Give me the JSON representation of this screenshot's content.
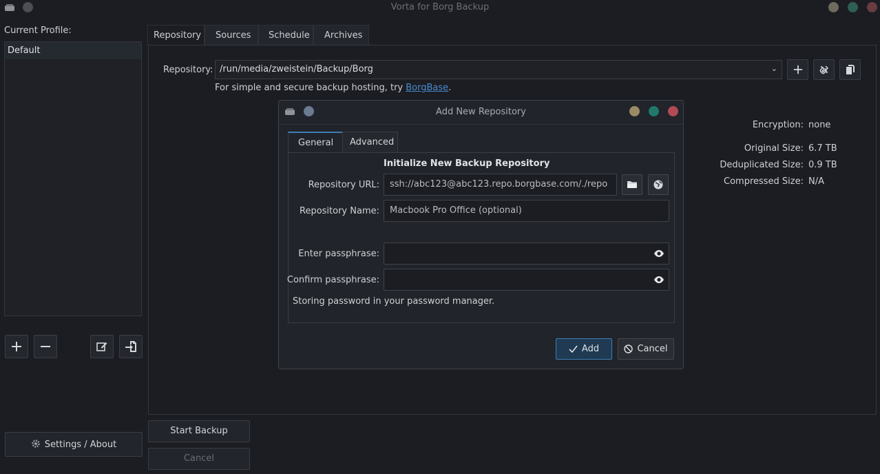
{
  "window": {
    "title": "Vorta for Borg Backup"
  },
  "sidebar": {
    "current_profile_label": "Current Profile:",
    "profiles": [
      "Default"
    ],
    "settings_label": "Settings / About"
  },
  "main_tabs": [
    "Repository",
    "Sources",
    "Schedule",
    "Archives"
  ],
  "repository": {
    "label": "Repository:",
    "value": "/run/media/zweistein/Backup/Borg",
    "hint_prefix": "For simple and secure backup hosting, try ",
    "hint_link": "BorgBase",
    "hint_suffix": "."
  },
  "stats": {
    "encryption_label": "Encryption:",
    "encryption_value": "none",
    "original_label": "Original Size:",
    "original_value": "6.7 TB",
    "dedup_label": "Deduplicated Size:",
    "dedup_value": "0.9 TB",
    "compressed_label": "Compressed Size:",
    "compressed_value": "N/A"
  },
  "actions": {
    "start_backup": "Start Backup",
    "cancel": "Cancel"
  },
  "dialog": {
    "title": "Add New Repository",
    "tabs": [
      "General",
      "Advanced"
    ],
    "heading": "Initialize New Backup Repository",
    "url_label": "Repository URL:",
    "url_placeholder": "ssh://abc123@abc123.repo.borgbase.com/./repo",
    "name_label": "Repository Name:",
    "name_placeholder": "Macbook Pro Office (optional)",
    "pass_label": "Enter passphrase:",
    "confirm_label": "Confirm passphrase:",
    "storage_note": "Storing password in your password manager.",
    "add_label": "Add",
    "cancel_label": "Cancel"
  },
  "colors": {
    "accent": "#3d7fb8",
    "link": "#4a8bd1",
    "close": "#b04a54",
    "maximize": "#1f7a6a",
    "minimize": "#9a8a66"
  }
}
